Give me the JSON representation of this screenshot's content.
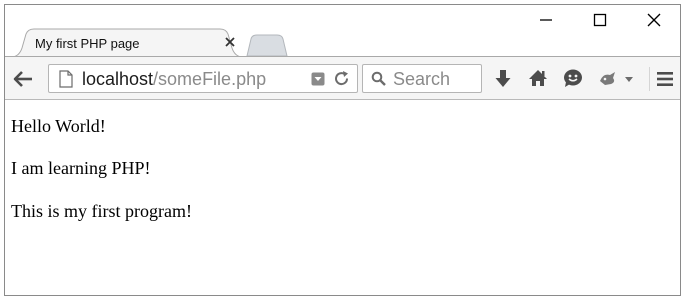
{
  "window": {
    "controls": {
      "minimize": "minimize-icon",
      "maximize": "maximize-icon",
      "close": "close-icon"
    }
  },
  "tab": {
    "title": "My first PHP page",
    "close_icon": "close-icon"
  },
  "navbar": {
    "url_host": "localhost",
    "url_path": "/someFile.php",
    "search_placeholder": "Search",
    "icons": [
      "back-arrow-icon",
      "page-icon",
      "dropdown-icon",
      "reload-icon",
      "search-icon",
      "download-icon",
      "home-icon",
      "hello-chat-icon",
      "addon-icon",
      "menu-icon"
    ]
  },
  "page": {
    "lines": [
      "Hello World!",
      "I am learning PHP!",
      "This is my first program!"
    ]
  },
  "colors": {
    "toolbar": "#f5f5f5",
    "border": "#b5b5b5",
    "icon": "#4c4c4c",
    "text": "#000000"
  }
}
